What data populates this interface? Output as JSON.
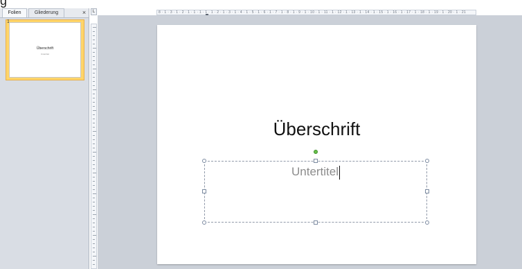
{
  "top": {
    "partial_title": "g"
  },
  "panel": {
    "tabs": [
      {
        "label": "Folien",
        "active": true
      },
      {
        "label": "Gliederung",
        "active": false
      }
    ],
    "close_label": "×",
    "slide_number": "1",
    "thumb_title": "Überschrift",
    "thumb_subtitle": "Untertitel"
  },
  "ruler": {
    "corner_label": "L",
    "horizontal_text": "8 · 1 · 3 · 1 · 2 · 1 · 1 · 1 · 1 · 1 · 2 · 1 · 3 · 1 · 4 · 1 · 5 · 1 · 6 · 1 · 7 · 1 · 8 · 1 · 9 · 1 · 10 · 1 · 11 · 1 · 12 · 1 · 13 · 1 · 14 · 1 · 15 · 1 · 16 · 1 · 17 · 1 · 18 · 1 · 19 · 1 · 20 · 1 · 21"
  },
  "slide": {
    "title": "Überschrift",
    "subtitle": "Untertitel"
  },
  "colors": {
    "selection_accent": "#ffd56a",
    "rotation_handle": "#6ac04a",
    "workspace_bg": "#cbd0d8"
  }
}
